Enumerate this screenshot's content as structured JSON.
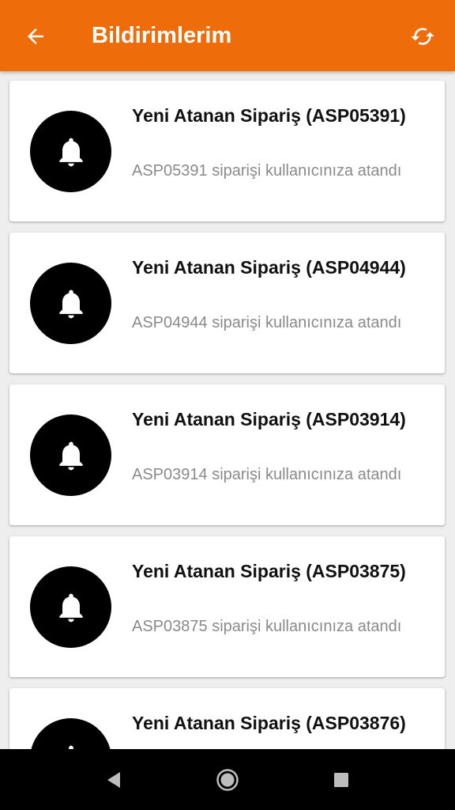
{
  "app_bar": {
    "title": "Bildirimlerim",
    "back_icon": "arrow-left-icon",
    "refresh_icon": "refresh-icon",
    "background_color": "#ef6c0b"
  },
  "notifications": [
    {
      "title": "Yeni Atanan Sipariş (ASP05391)",
      "body": "ASP05391 siparişi kullanıcınıza atandı",
      "icon": "bell-icon"
    },
    {
      "title": "Yeni Atanan Sipariş (ASP04944)",
      "body": "ASP04944 siparişi kullanıcınıza atandı",
      "icon": "bell-icon"
    },
    {
      "title": "Yeni Atanan Sipariş (ASP03914)",
      "body": "ASP03914 siparişi kullanıcınıza atandı",
      "icon": "bell-icon"
    },
    {
      "title": "Yeni Atanan Sipariş (ASP03875)",
      "body": "ASP03875 siparişi kullanıcınıza atandı",
      "icon": "bell-icon"
    },
    {
      "title": "Yeni Atanan Sipariş (ASP03876)",
      "body": "",
      "icon": "bell-icon"
    }
  ],
  "system_nav": {
    "back_icon": "nav-back-icon",
    "home_icon": "nav-home-icon",
    "recents_icon": "nav-recents-icon"
  }
}
